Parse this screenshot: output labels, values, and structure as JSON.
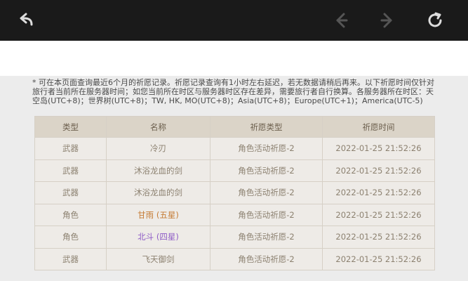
{
  "toolbar": {
    "back_icon": "back-arrow-icon",
    "prev_icon": "previous-icon",
    "next_icon": "next-icon",
    "refresh_icon": "refresh-icon"
  },
  "notice": "* 可在本页面查询最近6个月的祈愿记录。祈愿记录查询有1小时左右延迟，若无数据请稍后再来。以下祈愿时间仅针对旅行者当前所在服务器时间；如您当前所在时区与服务器时区存在差异，需要旅行者自行换算。各服务器所在时区：天空岛(UTC+8)；世界树(UTC+8)；TW, HK, MO(UTC+8)；Asia(UTC+8)；Europe(UTC+1)；America(UTC-5)",
  "table": {
    "headers": [
      "类型",
      "名称",
      "祈愿类型",
      "祈愿时间"
    ],
    "rows": [
      {
        "type": "武器",
        "name": "冷刃",
        "wish": "角色活动祈愿-2",
        "time": "2022-01-25 21:52:26",
        "rarity": "normal"
      },
      {
        "type": "武器",
        "name": "沐浴龙血的剑",
        "wish": "角色活动祈愿-2",
        "time": "2022-01-25 21:52:26",
        "rarity": "normal"
      },
      {
        "type": "武器",
        "name": "沐浴龙血的剑",
        "wish": "角色活动祈愿-2",
        "time": "2022-01-25 21:52:26",
        "rarity": "normal"
      },
      {
        "type": "角色",
        "name": "甘雨 (五星)",
        "wish": "角色活动祈愿-2",
        "time": "2022-01-25 21:52:26",
        "rarity": "five"
      },
      {
        "type": "角色",
        "name": "北斗 (四星)",
        "wish": "角色活动祈愿-2",
        "time": "2022-01-25 21:52:26",
        "rarity": "four"
      },
      {
        "type": "武器",
        "name": "飞天御剑",
        "wish": "角色活动祈愿-2",
        "time": "2022-01-25 21:52:26",
        "rarity": "normal"
      }
    ]
  },
  "colors": {
    "five_star": "#c57b34",
    "four_star": "#8e5cc6",
    "header_bg": "#dbd4c8",
    "cell_bg": "#eeebe7"
  }
}
